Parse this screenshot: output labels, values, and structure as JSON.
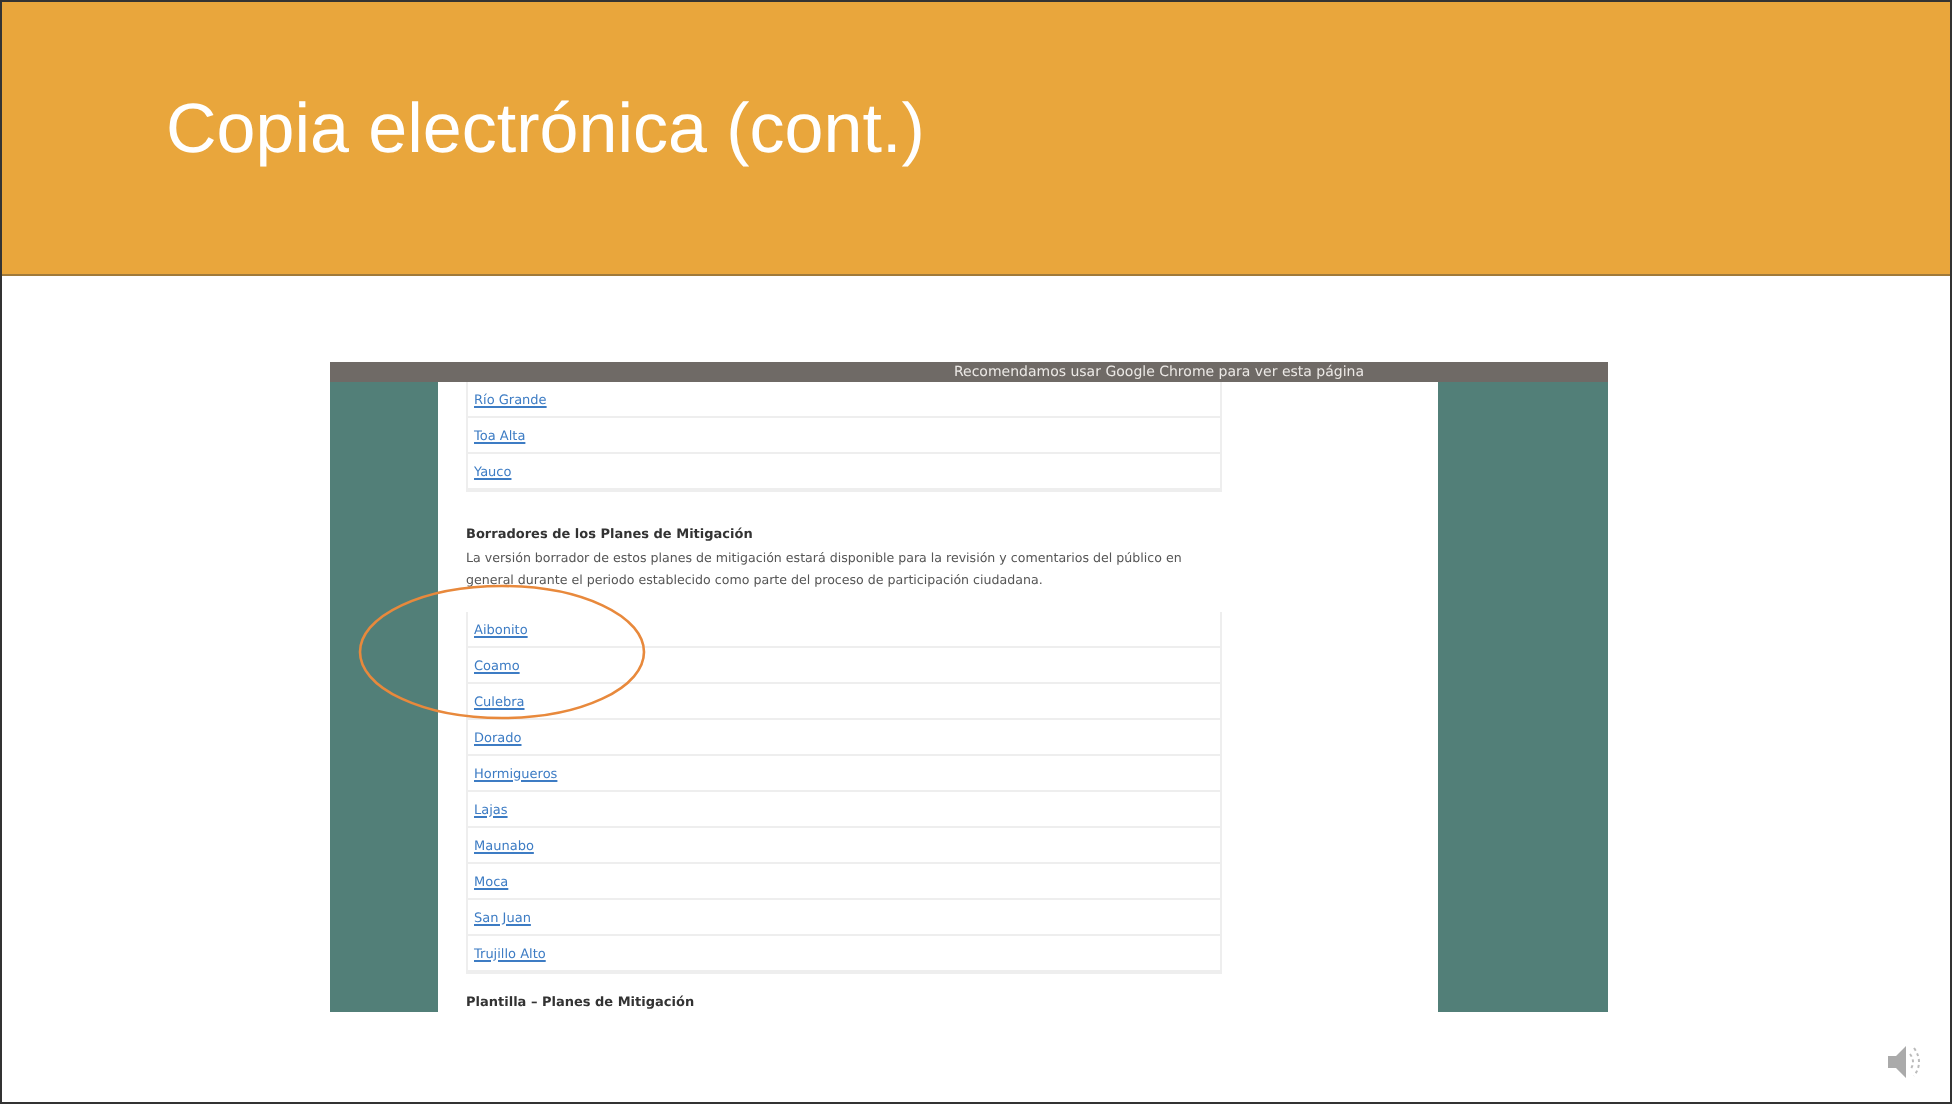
{
  "slide": {
    "title": "Copia electrónica (cont.)"
  },
  "screenshot": {
    "banner": "Recomendamos usar Google Chrome para ver esta página",
    "top_links": [
      "Río Grande",
      "Toa Alta",
      "Yauco"
    ],
    "section_heading": "Borradores de los Planes de Mitigación",
    "section_text": "La versión borrador de estos planes de mitigación estará disponible para la revisión y comentarios del público en general durante el periodo establecido como parte del proceso de participación ciudadana.",
    "draft_links": [
      "Aibonito",
      "Coamo",
      "Culebra",
      "Dorado",
      "Hormigueros",
      "Lajas",
      "Maunabo",
      "Moca",
      "San Juan",
      "Trujillo Alto"
    ],
    "next_heading": "Plantilla – Planes de Mitigación"
  }
}
